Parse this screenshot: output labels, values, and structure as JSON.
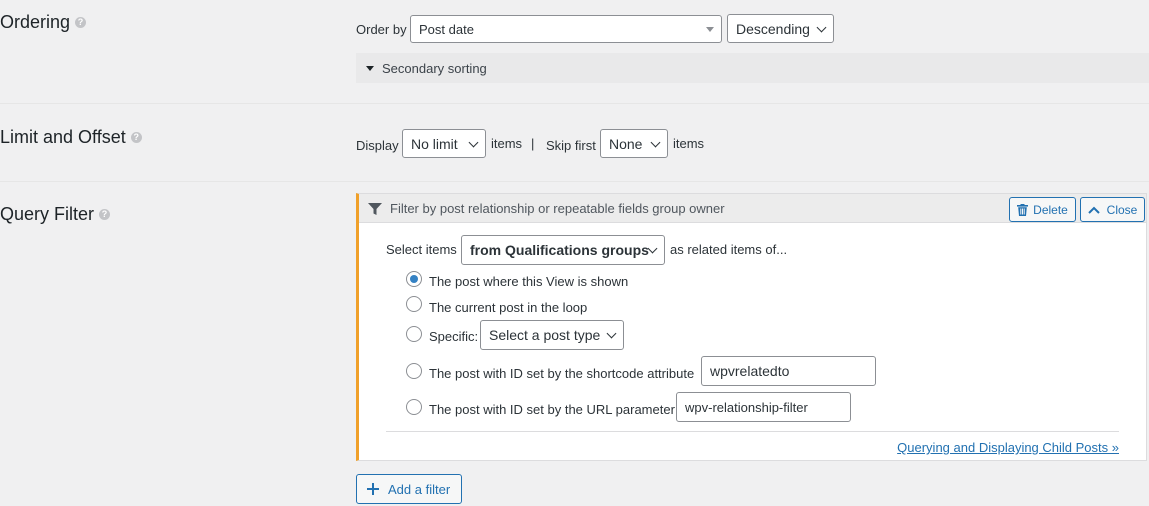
{
  "ordering": {
    "title": "Ordering",
    "order_by_label": "Order by",
    "order_by_value": "Post date",
    "direction_value": "Descending",
    "secondary_label": "Secondary sorting"
  },
  "limit": {
    "title": "Limit and Offset",
    "display_label": "Display",
    "display_value": "No limit",
    "items_label": "items",
    "separator": "|",
    "skip_label": "Skip first",
    "skip_value": "None",
    "items_label2": "items"
  },
  "query_filter": {
    "title": "Query Filter",
    "header_text": "Filter by post relationship or repeatable fields group owner",
    "delete_label": "Delete",
    "close_label": "Close",
    "select_items_label": "Select items",
    "select_items_value": "from Qualifications groups",
    "related_label": "as related items of...",
    "options": [
      {
        "label": "The post where this View is shown",
        "checked": true
      },
      {
        "label": "The current post in the loop",
        "checked": false
      },
      {
        "label": "Specific:",
        "checked": false
      },
      {
        "label": "The post with ID set by the shortcode attribute",
        "checked": false
      },
      {
        "label": "The post with ID set by the URL parameter",
        "checked": false
      }
    ],
    "post_type_select": "Select a post type",
    "shortcode_attr_value": "wpvrelatedto",
    "url_param_value": "wpv-relationship-filter",
    "doc_link": "Querying and Displaying Child Posts »"
  },
  "add_filter_label": "Add a filter",
  "icons": {
    "help": "help-icon",
    "filter": "filter-icon",
    "delete": "trash-icon",
    "close": "chevron-up-icon",
    "add": "plus-icon"
  },
  "colors": {
    "accent": "#2271b1",
    "filter_border": "#f0a02a",
    "radio_checked": "#3582c4"
  }
}
